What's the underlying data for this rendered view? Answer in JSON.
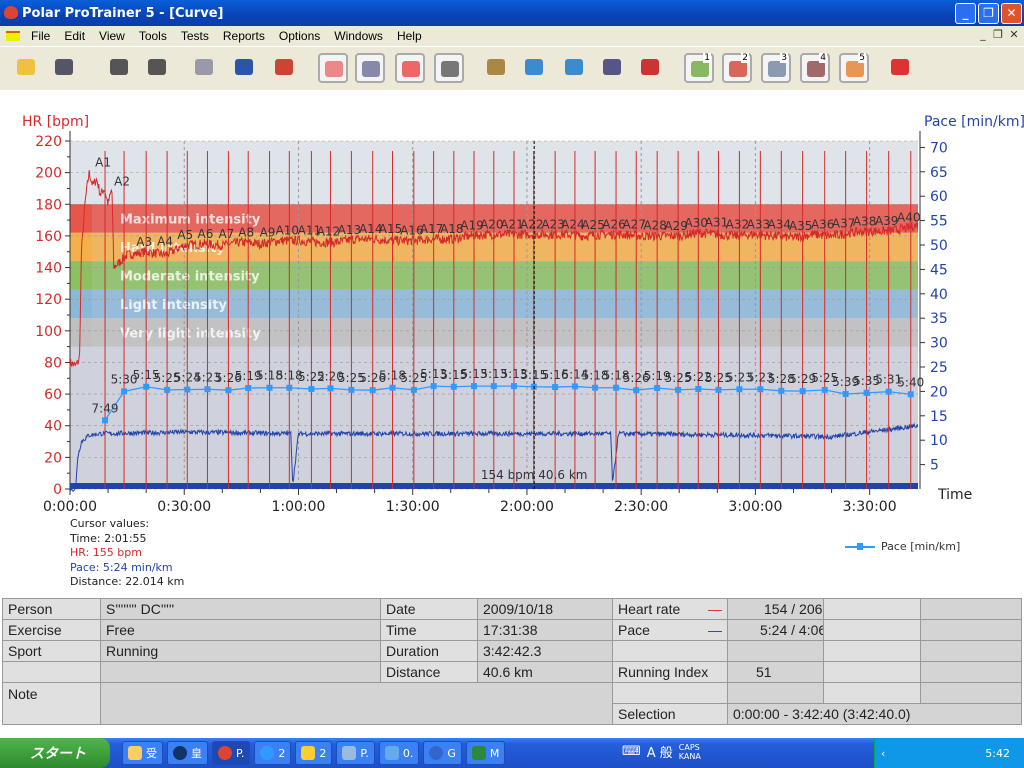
{
  "window": {
    "title": "Polar ProTrainer 5 - [Curve]",
    "minimize": "_",
    "restore": "❐",
    "close": "✕"
  },
  "menu": [
    "File",
    "Edit",
    "View",
    "Tools",
    "Tests",
    "Reports",
    "Options",
    "Windows",
    "Help"
  ],
  "mdi_controls": [
    "_",
    "❐",
    "✕"
  ],
  "toolbar": [
    "open-folder-icon",
    "save-icon",
    "sync-icon",
    "settings-icon",
    "calendar-icon",
    "diary-icon",
    "person-info-icon",
    "curve-view-icon",
    "bar-view-icon",
    "zones-percent-icon",
    "table-view-icon",
    "zoom-1-1-icon",
    "info-curve-icon",
    "info-lap-icon",
    "compare-icon",
    "series-select-icon",
    "view-1-icon",
    "view-2-icon",
    "view-3-icon",
    "view-4-icon",
    "view-5-icon",
    "users-icon"
  ],
  "toolbar_view_numbers": [
    "1",
    "2",
    "3",
    "4",
    "5"
  ],
  "chart_data": {
    "type": "line",
    "ylabel": "HR [bpm]",
    "y2label": "Pace [min/km]",
    "xlabel": "Time",
    "ylim": [
      0,
      220
    ],
    "yticks": [
      0,
      20,
      40,
      60,
      80,
      100,
      120,
      140,
      160,
      180,
      200,
      220
    ],
    "y2lim": [
      0,
      70
    ],
    "y2ticks": [
      5,
      10,
      15,
      20,
      25,
      30,
      35,
      40,
      45,
      50,
      55,
      60,
      65,
      70
    ],
    "xlim_min": [
      0,
      222.7
    ],
    "xticks": [
      "0:00:00",
      "0:30:00",
      "1:00:00",
      "1:30:00",
      "2:00:00",
      "2:30:00",
      "3:00:00",
      "3:30:00"
    ],
    "colors": {
      "hr": "#d42a2a",
      "pace": "#3399ff",
      "lower": "#2244aa",
      "laps": "#d42a2a"
    },
    "zones": [
      {
        "name": "Maximum intensity",
        "from": 162,
        "to": 180,
        "color": "#e8564a"
      },
      {
        "name": "Hard intensity",
        "from": 144,
        "to": 162,
        "color": "#f4b04a"
      },
      {
        "name": "Moderate intensity",
        "from": 126,
        "to": 144,
        "color": "#8cc060"
      },
      {
        "name": "Light intensity",
        "from": 108,
        "to": 126,
        "color": "#8cb8d8"
      },
      {
        "name": "Very light intensity",
        "from": 90,
        "to": 108,
        "color": "#c0c0c0"
      }
    ],
    "hr_series": {
      "t": [
        0,
        1.5,
        2.5,
        3,
        4,
        5,
        6,
        7,
        8,
        9,
        10,
        11,
        11.5,
        15,
        20,
        25,
        30,
        35,
        40,
        45,
        50,
        55,
        60,
        65,
        70,
        75,
        80,
        85,
        90,
        95,
        100,
        105,
        110,
        115,
        120,
        125,
        130,
        135,
        140,
        145,
        150,
        155,
        160,
        165,
        170,
        175,
        180,
        185,
        190,
        195,
        200,
        205,
        210,
        215,
        220,
        222.7
      ],
      "hr": [
        80,
        78,
        82,
        150,
        182,
        200,
        192,
        196,
        186,
        190,
        180,
        190,
        140,
        148,
        150,
        148,
        154,
        155,
        154,
        156,
        155,
        157,
        157,
        156,
        156,
        158,
        158,
        157,
        157,
        158,
        158,
        160,
        161,
        161,
        161,
        161,
        161,
        160,
        161,
        161,
        160,
        160,
        160,
        162,
        161,
        160,
        161,
        160,
        159,
        161,
        160,
        162,
        163,
        163,
        165,
        167
      ]
    },
    "lower_series": {
      "t": [
        0,
        1.5,
        2,
        3,
        5,
        8,
        10,
        30,
        58,
        58.5,
        60,
        100,
        142,
        142.5,
        144,
        180,
        200,
        222.7
      ],
      "value": [
        0,
        0,
        20,
        30,
        34,
        35,
        35,
        36,
        35,
        3,
        35,
        35,
        35,
        3,
        35,
        34,
        33,
        40
      ]
    },
    "laps": {
      "labels": [
        "A1",
        "A2",
        "A3",
        "A4",
        "A5",
        "A6",
        "A7",
        "A8",
        "A9",
        "A10",
        "A11",
        "A12",
        "A13",
        "A14",
        "A15",
        "A16",
        "A17",
        "A18",
        "A19",
        "A20",
        "A21",
        "A22",
        "A23",
        "A24",
        "A25",
        "A26",
        "A27",
        "A28",
        "A29",
        "A30",
        "A31",
        "A32",
        "A33",
        "A34",
        "A35",
        "A36",
        "A37",
        "A38",
        "A39",
        "A40"
      ],
      "end_min": [
        9.2,
        14.2,
        20.0,
        25.5,
        30.8,
        36.1,
        41.6,
        46.8,
        52.4,
        57.6,
        63.4,
        68.4,
        73.9,
        79.5,
        84.7,
        90.3,
        95.5,
        100.8,
        106.1,
        111.3,
        116.6,
        121.8,
        127.4,
        132.6,
        137.9,
        143.4,
        148.7,
        154.2,
        159.7,
        165.0,
        170.3,
        175.8,
        181.3,
        186.8,
        192.4,
        198.2,
        203.7,
        209.2,
        215.0,
        220.8
      ],
      "pace": [
        "7:49",
        "5:30",
        "5:15",
        "5:25",
        "5:24",
        "5:23",
        "5:26",
        "5:19",
        "5:18",
        "5:18",
        "5:22",
        "5:20",
        "5:25",
        "5:26",
        "5:18",
        "5:25",
        "5:13",
        "5:15",
        "5:13",
        "5:13",
        "5:13",
        "5:15",
        "5:16",
        "5:14",
        "5:18",
        "5:18",
        "5:26",
        "5:19",
        "5:25",
        "5:22",
        "5:25",
        "5:23",
        "5:23",
        "5:28",
        "5:29",
        "5:25",
        "5:39",
        "5:35",
        "5:31",
        "5:40"
      ]
    },
    "cursor_min": 121.9,
    "marker_label": "154 bpm 40.6 km",
    "legend": "Pace [min/km]",
    "legend_position": "bottom-right",
    "grid": true
  },
  "cursor_values": {
    "title": "Cursor values:",
    "time": "Time: 2:01:55",
    "hr": "HR: 155 bpm",
    "pace": "Pace: 5:24 min/km",
    "distance": "Distance: 22.014 km"
  },
  "info": {
    "person_label": "Person",
    "person": "S'''''''' DC'''''",
    "exercise_label": "Exercise",
    "exercise": "Free",
    "sport_label": "Sport",
    "sport": "Running",
    "note_label": "Note",
    "date_label": "Date",
    "date": "2009/10/18",
    "time_label": "Time",
    "time": "17:31:38",
    "duration_label": "Duration",
    "duration": "3:42:42.3",
    "distance_label": "Distance",
    "distance": "40.6 km",
    "hr_label": "Heart rate",
    "hr": "154 / 206",
    "pace_label": "Pace",
    "pace": "5:24 / 4:06",
    "ri_label": "Running Index",
    "ri": "51",
    "selection_label": "Selection",
    "selection": "0:00:00 - 3:42:40 (3:42:40.0)"
  },
  "taskbar": {
    "start": "スタート",
    "tasks": [
      "受",
      "皇",
      "P.",
      "2",
      "2",
      "P.",
      "0.",
      "G",
      "M"
    ],
    "ime": "A 般",
    "caps": "CAPS",
    "kana": "KANA",
    "clock": "5:42"
  }
}
